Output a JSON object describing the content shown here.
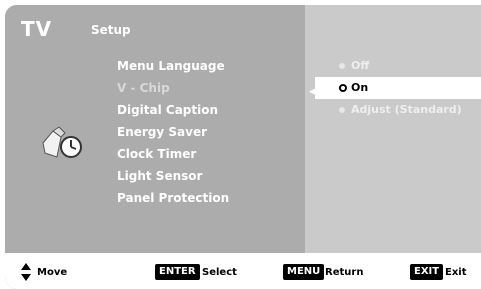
{
  "header": {
    "brand": "TV",
    "section": "Setup"
  },
  "menu": {
    "items": [
      {
        "label": "Menu Language",
        "state": "normal"
      },
      {
        "label": "V - Chip",
        "state": "active"
      },
      {
        "label": "Digital Caption",
        "state": "normal"
      },
      {
        "label": "Energy Saver",
        "state": "normal"
      },
      {
        "label": "Clock Timer",
        "state": "normal"
      },
      {
        "label": "Light Sensor",
        "state": "normal"
      },
      {
        "label": "Panel Protection",
        "state": "normal"
      }
    ]
  },
  "options": {
    "items": [
      {
        "label": "Off",
        "selected": false
      },
      {
        "label": "On",
        "selected": true
      },
      {
        "label": "Adjust (Standard)",
        "selected": false
      }
    ]
  },
  "footer": {
    "move_label": "Move",
    "enter_key": "ENTER",
    "select_label": "Select",
    "menu_key": "MENU",
    "return_label": "Return",
    "exit_key": "EXIT",
    "exit_label": "Exit"
  },
  "colors": {
    "left_pane": "#a8a8a8",
    "right_pane": "#c6c6c6",
    "highlight": "#ffffff",
    "footer": "#ffffff"
  },
  "icons": {
    "setup": "setup-clock-icon",
    "move": "up-down-arrow-icon"
  }
}
